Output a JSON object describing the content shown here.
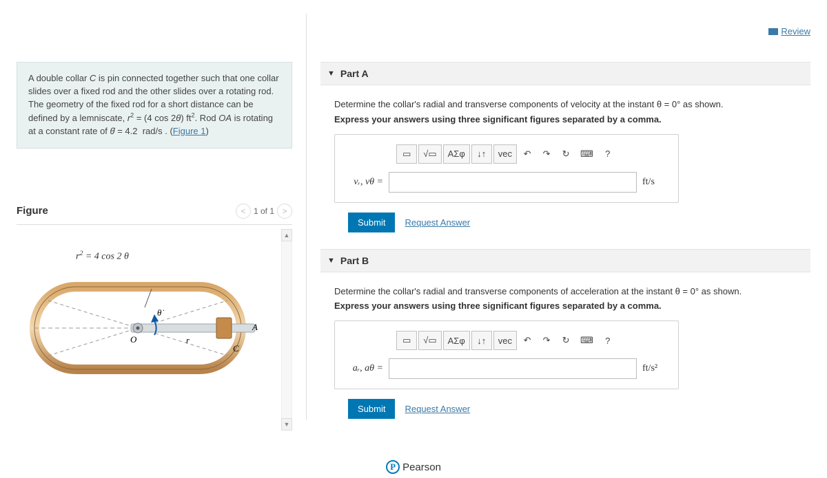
{
  "header": {
    "review_label": "Review"
  },
  "intro": {
    "text_html": "A double collar <i>C</i> is pin connected together such that one collar slides over a fixed rod and the other slides over a rotating rod. The geometry of the fixed rod for a short distance can be defined by a lemniscate, <i>r</i><sup>2</sup> = (4 cos 2<i>θ</i>) ft<sup>2</sup>. Rod <i>OA</i> is rotating at a constant rate of <i>θ̇</i> = 4.2&nbsp; rad/s . (",
    "figure_link": "Figure 1",
    "text_tail": ")"
  },
  "figure": {
    "title": "Figure",
    "counter": "1 of 1",
    "equation": "r² = 4 cos 2 θ",
    "labels": {
      "O": "O",
      "A": "A",
      "C": "C",
      "r": "r",
      "thetadot": "θ̇"
    }
  },
  "parts": [
    {
      "id": "A",
      "title": "Part A",
      "question": "Determine the collar's radial and transverse components of velocity at the instant θ = 0° as shown.",
      "instruction": "Express your answers using three significant figures separated by a comma.",
      "var_label": "vᵣ, vθ =",
      "units": "ft/s",
      "submit": "Submit",
      "request": "Request Answer"
    },
    {
      "id": "B",
      "title": "Part B",
      "question": "Determine the collar's radial and transverse components of acceleration at the instant θ = 0° as shown.",
      "instruction": "Express your answers using three significant figures separated by a comma.",
      "var_label": "aᵣ, aθ =",
      "units": "ft/s²",
      "submit": "Submit",
      "request": "Request Answer"
    }
  ],
  "toolbar": {
    "templates": "▭",
    "sqrt": "√▭",
    "greek": "ΑΣφ",
    "subscript": "↓↑",
    "vec": "vec",
    "undo": "↶",
    "redo": "↷",
    "reset": "↻",
    "keyboard": "⌨",
    "help": "?"
  },
  "footer": {
    "brand": "Pearson"
  }
}
